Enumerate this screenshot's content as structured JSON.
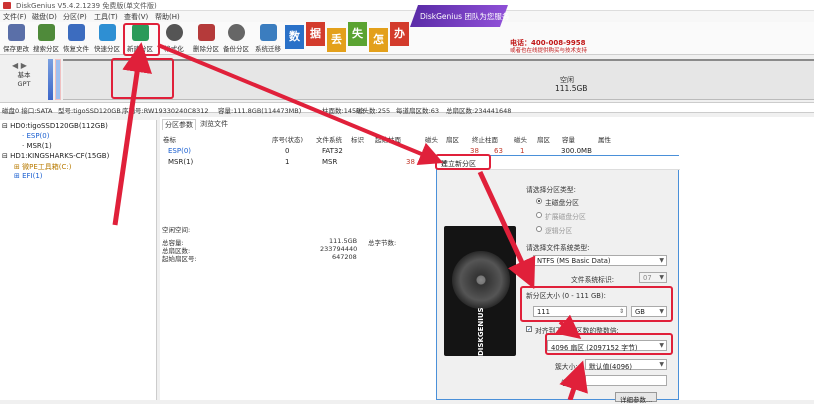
{
  "app": {
    "title": "DiskGenius V5.4.2.1239 免费版(单文件版)"
  },
  "menu": [
    "文件(F)",
    "磁盘(D)",
    "分区(P)",
    "工具(T)",
    "查看(V)",
    "帮助(H)"
  ],
  "toolbar": {
    "items": [
      {
        "label": "保存更改",
        "color": "#5a6fa8"
      },
      {
        "label": "搜索分区",
        "color": "#4f8a3a"
      },
      {
        "label": "恢复文件",
        "color": "#3c6cbf"
      },
      {
        "label": "快速分区",
        "color": "#2e8fd3"
      },
      {
        "label": "新建分区",
        "color": "#2a9a5a"
      },
      {
        "label": "格式化",
        "color": "#555555"
      },
      {
        "label": "删除分区",
        "color": "#b53a3a"
      },
      {
        "label": "备份分区",
        "color": "#666666"
      },
      {
        "label": "系统迁移",
        "color": "#3b7dbf"
      }
    ]
  },
  "banner": {
    "tiles": [
      {
        "char": "数",
        "color": "#2a71c8"
      },
      {
        "char": "据",
        "color": "#d33b2c"
      },
      {
        "char": "丢",
        "color": "#e3a01b"
      },
      {
        "char": "失",
        "color": "#5aa331"
      },
      {
        "char": "怎",
        "color": "#e3a01b"
      },
      {
        "char": "办",
        "color": "#d33b2c"
      }
    ],
    "slogan": "DiskGenius 团队为您服务",
    "phone": "电话：400-008-9958",
    "phone_sub": "或者也在线提供购买与技术支持"
  },
  "disk_strip": {
    "type_line1": "基本",
    "type_line2": "GPT",
    "free_label": "空闲",
    "free_size": "111.5GB"
  },
  "disk_info": {
    "disk": "磁盘0 接口:SATA",
    "model": "型号:tigoSSD120GB",
    "serial": "序列号:RW19330240C8312",
    "capacity": "容量:111.8GB(114473MB)",
    "cylinders": "柱面数:14593",
    "heads": "磁头数:255",
    "sectors_per_track": "每道扇区数:63",
    "total_sectors": "总扇区数:234441648"
  },
  "tree": [
    {
      "text": "HD0:tigoSSD120GB(112GB)",
      "color": "#222222"
    },
    {
      "text": "ESP(0)",
      "color": "#1a5fd0"
    },
    {
      "text": "MSR(1)",
      "color": "#222222"
    },
    {
      "text": "HD1:KINGSHARKS-CF(15GB)",
      "color": "#222222"
    },
    {
      "text": "微PE工具箱(C:)",
      "color": "#b87a00"
    },
    {
      "text": "EFI(1)",
      "color": "#1a5fd0"
    }
  ],
  "tabs": [
    "分区参数",
    "浏览文件"
  ],
  "columns": [
    "卷标",
    "序号(状态)",
    "文件系统",
    "标识",
    "起始柱面",
    "磁头",
    "扇区",
    "终止柱面",
    "磁头",
    "扇区",
    "容量",
    "属性"
  ],
  "partitions": [
    {
      "label": "ESP(0)",
      "num": "0",
      "fs": "FAT32",
      "id": "",
      "start_cyl": "",
      "h1": "",
      "s1": "",
      "end_cyl": "38",
      "h2": "63",
      "s2": "1",
      "size": "300.0MB",
      "label_color": "#1a5fd0"
    },
    {
      "label": "MSR(1)",
      "num": "1",
      "fs": "MSR",
      "id": "",
      "start_cyl": "38",
      "h1": "",
      "s1": "",
      "end_cyl": "",
      "h2": "",
      "s2": "",
      "size": "",
      "label_color": "#222222"
    }
  ],
  "free_space": {
    "header": "空闲空间:",
    "rows": [
      {
        "k": "总容量:",
        "v": "111.5GB"
      },
      {
        "k": "总扇区数:",
        "v": "233794440"
      },
      {
        "k": "起始扇区号:",
        "v": "647208"
      }
    ],
    "total_bytes_label": "总字节数:"
  },
  "dialog": {
    "title": "建立新分区",
    "type_label": "请选择分区类型:",
    "types": [
      {
        "label": "主磁盘分区",
        "selected": true
      },
      {
        "label": "扩展磁盘分区",
        "selected": false
      },
      {
        "label": "逻辑分区",
        "selected": false
      }
    ],
    "fs_label": "请选择文件系统类型:",
    "fs_value": "NTFS (MS Basic Data)",
    "fs_id_label": "文件系统标识:",
    "fs_id_value": "07",
    "size_label": "新分区大小 (0 - 111 GB):",
    "size_value": "111",
    "size_unit": "GB",
    "align_label": "对齐到下列扇区数的整数倍:",
    "align_checked": true,
    "align_value": "4096 扇区 (2097152 字节)",
    "cluster_label": "簇大小:",
    "cluster_value": "默认值(4096)",
    "vol_label": "卷标:",
    "details_button": "详细参数...",
    "brand": "DISKGENIUS"
  }
}
